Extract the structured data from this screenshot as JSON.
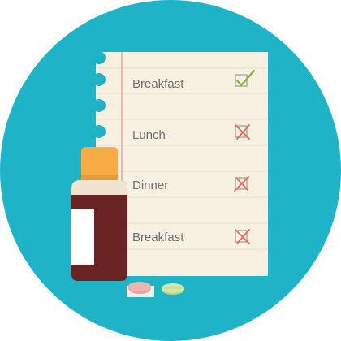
{
  "colors": {
    "background_circle": "#1fb3c8",
    "paper": "#f8f1e1",
    "ruled_line": "#f0c8c0",
    "margin_line": "#e7a7a1",
    "check_green": "#7fb23d",
    "cross_red": "#e56a5c",
    "bottle_body": "#6b2424",
    "bottle_cap": "#f7ac45",
    "bottle_label": "#efe5cf",
    "pill_pink": "#e8a1a1",
    "pill_green": "#cde3a0"
  },
  "checklist": {
    "items": [
      {
        "label": "Breakfast",
        "status": "checked",
        "icon": "checkmark-icon"
      },
      {
        "label": "Lunch",
        "status": "crossed",
        "icon": "cross-icon"
      },
      {
        "label": "Dinner",
        "status": "crossed",
        "icon": "cross-icon"
      },
      {
        "label": "Breakfast",
        "status": "crossed",
        "icon": "cross-icon"
      }
    ]
  },
  "illustration": {
    "bottle_icon": "medicine-bottle-icon",
    "pill_icons": [
      "pink-pill-icon",
      "green-pill-icon"
    ]
  }
}
